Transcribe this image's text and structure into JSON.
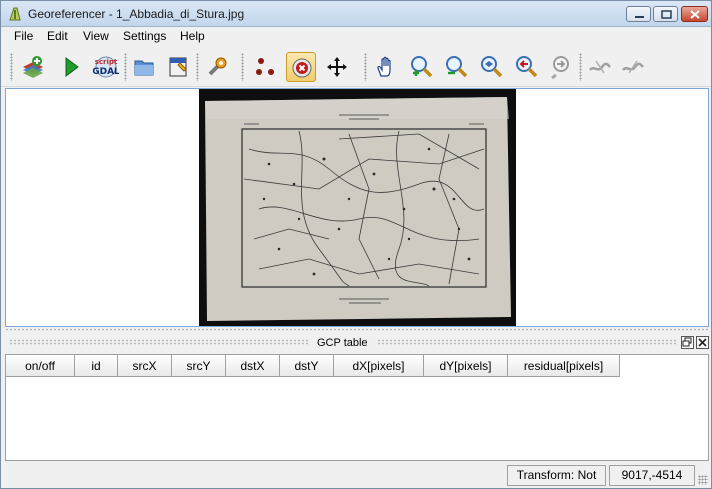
{
  "window": {
    "title": "Georeferencer - 1_Abbadia_di_Stura.jpg",
    "app_icon": "qgis-georeferencer-icon"
  },
  "menubar": {
    "items": [
      {
        "label": "File"
      },
      {
        "label": "Edit"
      },
      {
        "label": "View"
      },
      {
        "label": "Settings"
      },
      {
        "label": "Help"
      }
    ]
  },
  "toolbar": {
    "buttons": [
      {
        "icon": "open-raster-icon",
        "tooltip": "Open raster"
      },
      {
        "icon": "start-georeferencing-icon",
        "tooltip": "Start georeferencing"
      },
      {
        "icon": "generate-gdal-script-icon",
        "tooltip": "Generate GDAL script",
        "label_top": "script",
        "label_bottom": "GDAL"
      },
      {
        "icon": "load-gcp-points-icon",
        "tooltip": "Load GCP points"
      },
      {
        "icon": "save-gcp-points-icon",
        "tooltip": "Save GCP points as"
      },
      {
        "icon": "transformation-settings-icon",
        "tooltip": "Transformation settings"
      },
      {
        "icon": "add-point-icon",
        "tooltip": "Add point"
      },
      {
        "icon": "delete-point-icon",
        "tooltip": "Delete point",
        "active": true
      },
      {
        "icon": "move-gcp-point-icon",
        "tooltip": "Move GCP point"
      },
      {
        "icon": "pan-icon",
        "tooltip": "Pan"
      },
      {
        "icon": "zoom-in-icon",
        "tooltip": "Zoom in"
      },
      {
        "icon": "zoom-out-icon",
        "tooltip": "Zoom out"
      },
      {
        "icon": "zoom-to-layer-icon",
        "tooltip": "Zoom to layer"
      },
      {
        "icon": "zoom-last-icon",
        "tooltip": "Zoom last"
      },
      {
        "icon": "zoom-next-icon",
        "tooltip": "Zoom next"
      },
      {
        "icon": "link-georeferencer-to-qgis-icon",
        "tooltip": "Link georeferencer to QGIS"
      },
      {
        "icon": "link-qgis-to-georeferencer-icon",
        "tooltip": "Link QGIS to georeferencer"
      }
    ]
  },
  "gcp_dock": {
    "title": "GCP table",
    "columns": [
      "on/off",
      "id",
      "srcX",
      "srcY",
      "dstX",
      "dstY",
      "dX[pixels]",
      "dY[pixels]",
      "residual[pixels]"
    ],
    "rows": []
  },
  "statusbar": {
    "transform": "Transform: Not set",
    "coordinates": "9017,-4514"
  },
  "colors": {
    "canvas_border": "#7ea6d6",
    "active_tool": "#f2cd6b",
    "map_background": "#0e0e0e",
    "map_paper": "#cfcac2"
  }
}
